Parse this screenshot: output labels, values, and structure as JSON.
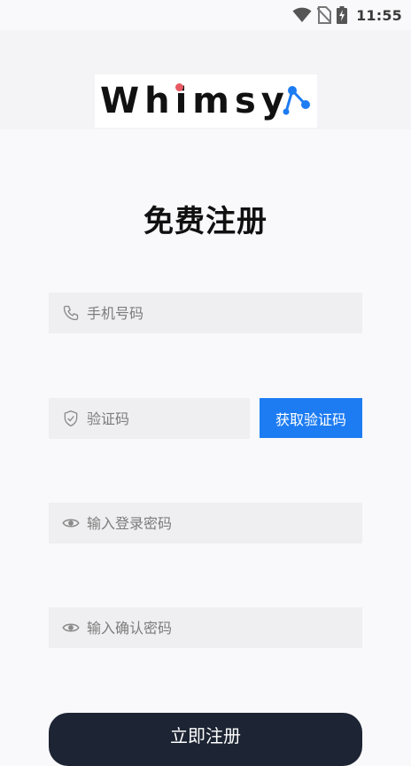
{
  "status_bar": {
    "time": "11:55",
    "icons": [
      "wifi-icon",
      "no-sim-icon",
      "battery-charging-icon"
    ]
  },
  "logo": {
    "text": "Whimsy"
  },
  "form": {
    "title": "免费注册",
    "phone_placeholder": "手机号码",
    "code_placeholder": "验证码",
    "get_code_label": "获取验证码",
    "password_placeholder": "输入登录密码",
    "confirm_placeholder": "输入确认密码",
    "submit_label": "立即注册"
  },
  "colors": {
    "accent": "#1d7cf2",
    "submit_bg": "#1d2433",
    "field_bg": "#efeef0",
    "logo_dot": "#e85a63"
  }
}
